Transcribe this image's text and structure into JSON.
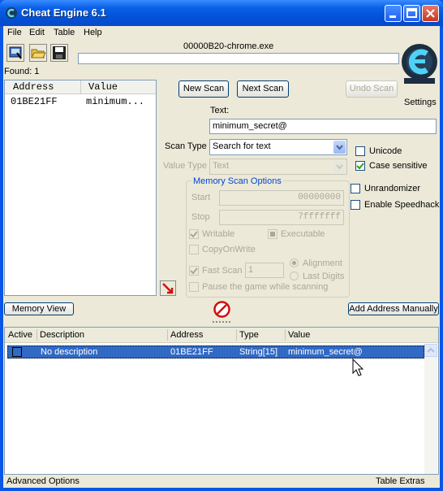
{
  "window": {
    "title": "Cheat Engine 6.1"
  },
  "menu": [
    "File",
    "Edit",
    "Table",
    "Help"
  ],
  "toolbar": {
    "icons": [
      "process-select-icon",
      "open-file-icon",
      "save-icon"
    ]
  },
  "process_title": "00000B20-chrome.exe",
  "found_label": "Found: 1",
  "address_list": {
    "headers": {
      "address": "Address",
      "value": "Value"
    },
    "rows": [
      {
        "address": "01BE21FF",
        "value": "minimum..."
      }
    ]
  },
  "buttons": {
    "new_scan": "New Scan",
    "next_scan": "Next Scan",
    "undo_scan": "Undo Scan",
    "settings": "Settings",
    "memory_view": "Memory View",
    "add_address_manually": "Add Address Manually"
  },
  "scan": {
    "text_label": "Text:",
    "text_value": "minimum_secret@",
    "scan_type_label": "Scan Type",
    "scan_type_value": "Search for text",
    "value_type_label": "Value Type",
    "value_type_value": "Text"
  },
  "options": {
    "unicode": "Unicode",
    "case_sensitive": "Case sensitive",
    "unrandomizer": "Unrandomizer",
    "enable_speedhack": "Enable Speedhack"
  },
  "memory_scan": {
    "title": "Memory Scan Options",
    "start_label": "Start",
    "start_value": "00000000",
    "stop_label": "Stop",
    "stop_value": "7fffffff",
    "writable": "Writable",
    "executable": "Executable",
    "copy_on_write": "CopyOnWrite",
    "fast_scan": "Fast Scan",
    "fast_scan_value": "1",
    "alignment": "Alignment",
    "last_digits": "Last Digits",
    "pause_game": "Pause the game while scanning"
  },
  "cheat_table": {
    "headers": {
      "active": "Active",
      "description": "Description",
      "address": "Address",
      "type": "Type",
      "value": "Value"
    },
    "rows": [
      {
        "description": "No description",
        "address": "01BE21FF",
        "type": "String[15]",
        "value": "minimum_secret@"
      }
    ]
  },
  "status": {
    "advanced_options": "Advanced Options",
    "table_extras": "Table Extras"
  },
  "colors": {
    "title_bar": "#0A56E6",
    "selection": "#316AC5",
    "group_title": "#0046D5"
  }
}
